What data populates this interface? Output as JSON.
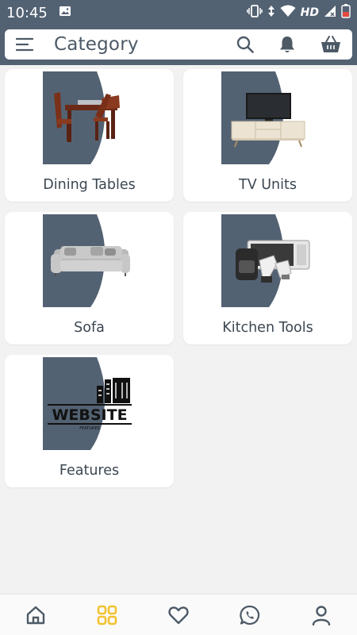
{
  "status_bar": {
    "time": "10:45",
    "network_label": "HD",
    "icons": [
      "image-notification-icon",
      "vibrate-icon",
      "data-arrows-icon",
      "wifi-icon",
      "signal-icon",
      "battery-icon"
    ]
  },
  "app_bar": {
    "title": "Category",
    "icons": [
      "menu-icon",
      "search-icon",
      "bell-icon",
      "shopping-basket-icon"
    ]
  },
  "categories": [
    {
      "label": "Dining Tables",
      "image": "dining-table-image"
    },
    {
      "label": "TV Units",
      "image": "tv-unit-image"
    },
    {
      "label": "Sofa",
      "image": "sofa-image"
    },
    {
      "label": "Kitchen Tools",
      "image": "kitchen-appliances-image"
    },
    {
      "label": "Features",
      "image": "website-features-logo-image"
    }
  ],
  "bottom_nav": {
    "items": [
      "home-icon",
      "grid-icon",
      "heart-icon",
      "whatsapp-icon",
      "user-icon"
    ],
    "active": "grid-icon"
  },
  "colors": {
    "primary": "#536273",
    "active_nav": "#f2c230",
    "background": "#f2f2f2",
    "card": "#ffffff",
    "text": "#3b4651"
  },
  "watermark_text": {
    "logo_line1": "WEBSITE",
    "logo_line2": "FEATURES"
  }
}
